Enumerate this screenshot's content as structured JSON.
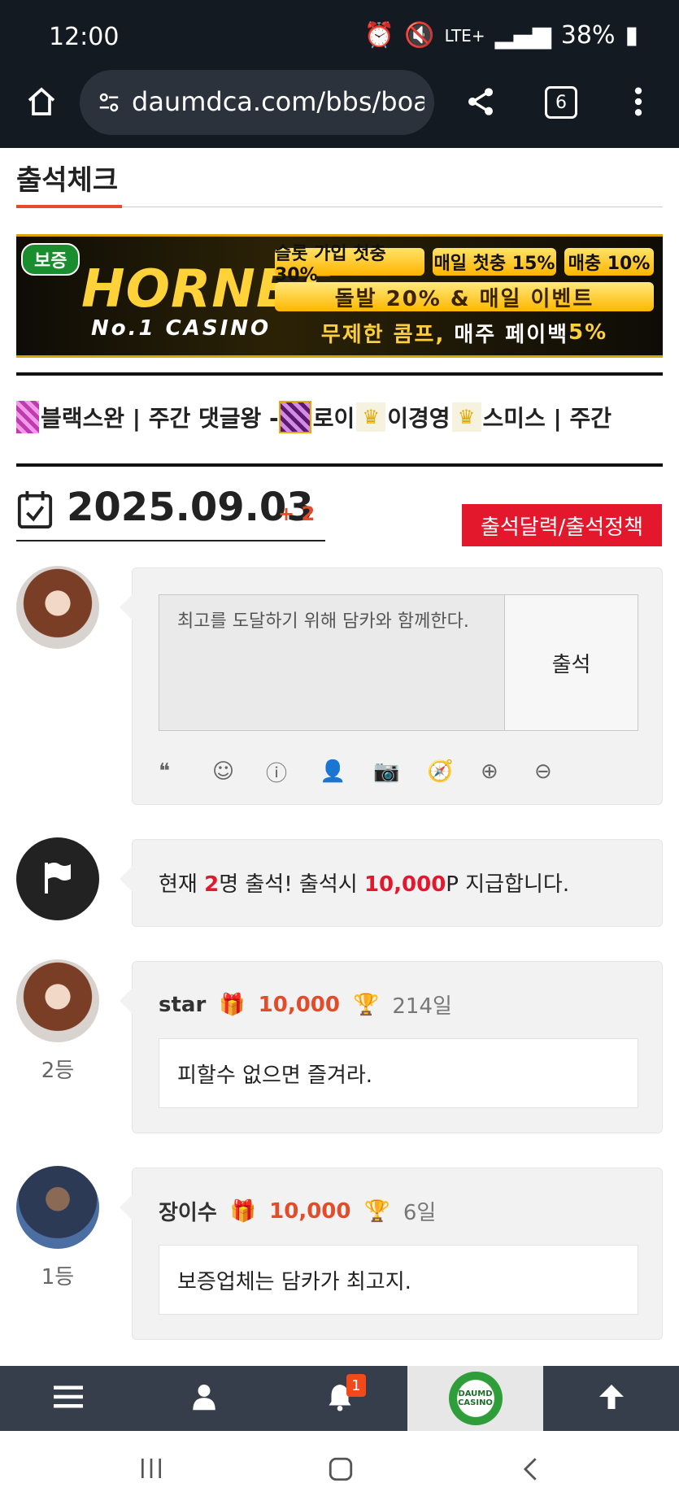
{
  "status_bar": {
    "time": "12:00",
    "network": "LTE+",
    "battery": "38%"
  },
  "browser": {
    "url": "daumdca.com/bbs/boa",
    "tab_count": "6"
  },
  "page": {
    "title": "출석체크"
  },
  "banner": {
    "badge": "보증",
    "brand": "HORNET",
    "sub": "No.1 CASINO",
    "chips": [
      "슬롯 가입 첫충 30%",
      "매일 첫충 15%",
      "매충 10%"
    ],
    "line2": "돌발 20% & 매일 이벤트",
    "line3_a": "무제한 콤프,",
    "line3_b": "매주 페이백",
    "line3_c": "5%"
  },
  "marquee": {
    "part1": "블랙스완 | 주간 댓글왕 - ",
    "part2": "로이",
    "part3": "이경영",
    "part4": "스미스 | 주간"
  },
  "attendance": {
    "date": "2025.09.03",
    "count_delta": "+ 2",
    "policy_button": "출석달력/출석정책",
    "input_placeholder": "최고를 도달하기 위해 담카와 함께한다.",
    "submit_label": "출석"
  },
  "notice": {
    "prefix": "현재 ",
    "count": "2",
    "middle": "명 출석! 출석시 ",
    "points": "10,000",
    "suffix": "P 지급합니다."
  },
  "entries": [
    {
      "rank": "2등",
      "name": "star",
      "points": "10,000",
      "days": "214일",
      "message": "피할수 없으면 즐겨라."
    },
    {
      "rank": "1등",
      "name": "장이수",
      "points": "10,000",
      "days": "6일",
      "message": "보증업체는 담카가 최고지."
    }
  ],
  "bottom_nav": {
    "notification_count": "1",
    "logo_text": "DAUMD CASINO"
  },
  "colors": {
    "accent": "#e34b2a",
    "red_button": "#e3182d",
    "nav_bg": "#363e4c",
    "browser_bg": "#141a22"
  }
}
